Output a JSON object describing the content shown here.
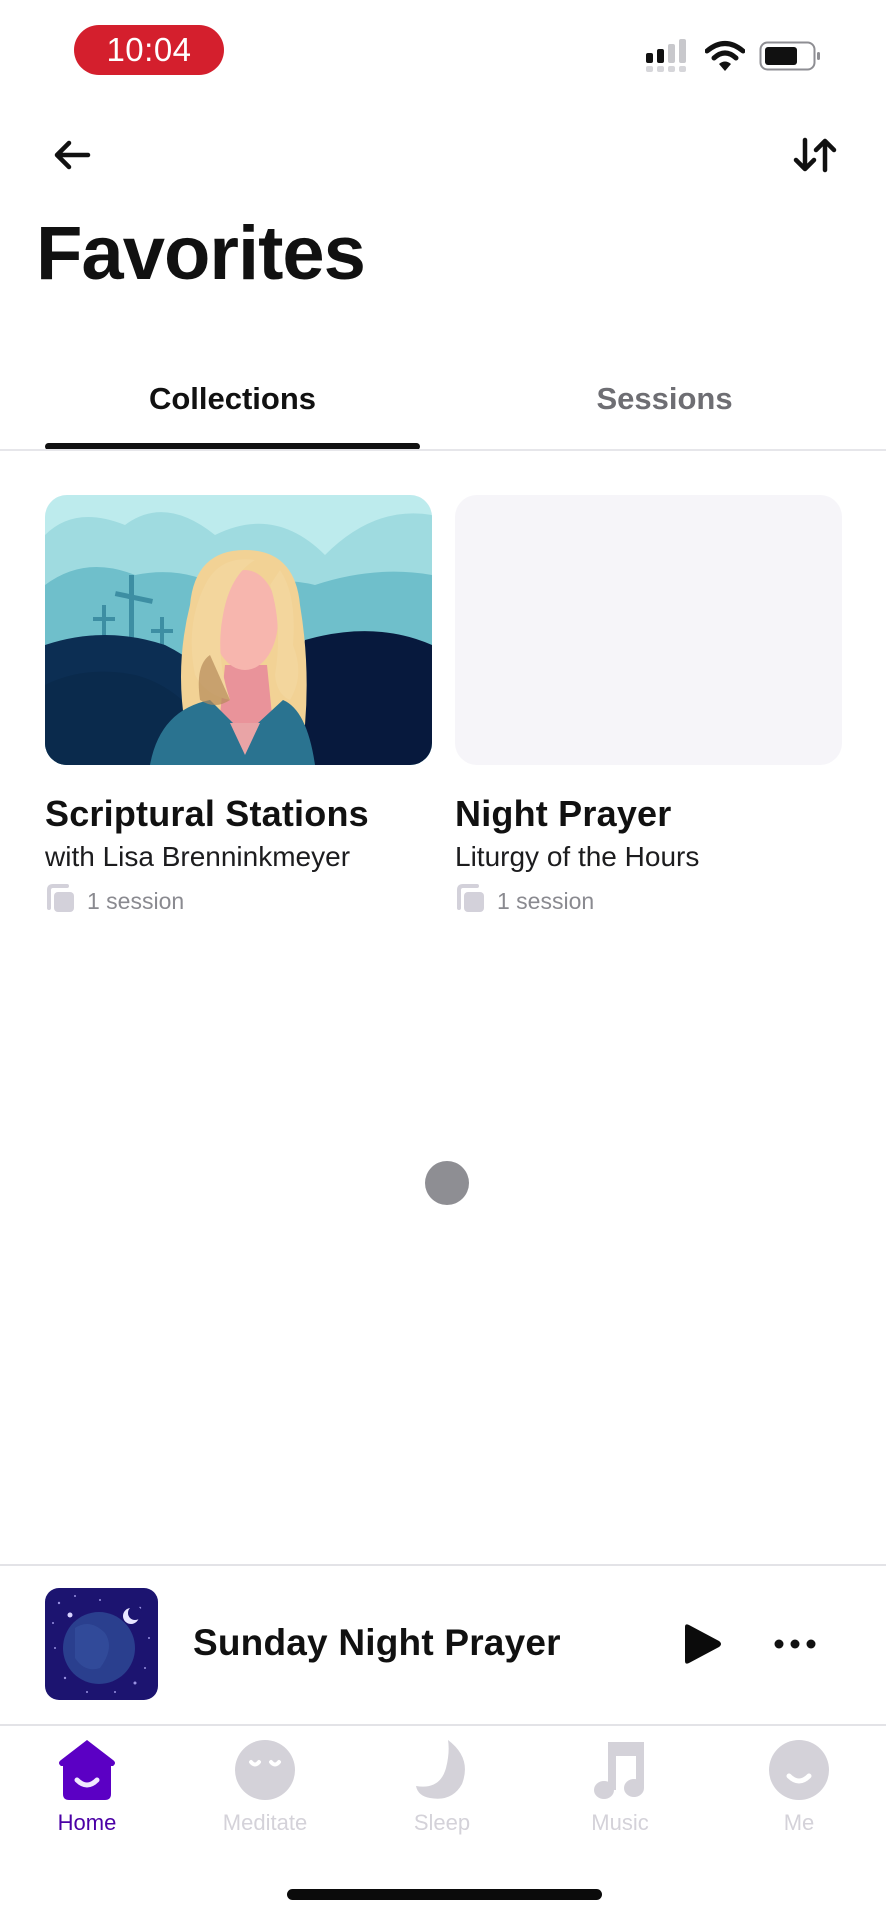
{
  "status_bar": {
    "time": "10:04",
    "signal_icon": "cellular-signal-icon",
    "wifi_icon": "wifi-icon",
    "battery_icon": "battery-icon",
    "time_pill_color": "#d41f2d"
  },
  "header": {
    "back_icon": "arrow-left-icon",
    "sort_icon": "sort-arrows-icon",
    "title": "Favorites"
  },
  "tabs": {
    "items": [
      {
        "label": "Collections",
        "active": true
      },
      {
        "label": "Sessions",
        "active": false
      }
    ]
  },
  "collections": [
    {
      "title": "Scriptural Stations",
      "subtitle": "with Lisa Brenninkmeyer",
      "sessions": "1 session",
      "image": "illustration-woman-three-crosses"
    },
    {
      "title": "Night Prayer",
      "subtitle": "Liturgy of the Hours",
      "sessions": "1 session",
      "image": "placeholder-loading"
    }
  ],
  "mini_player": {
    "title": "Sunday Night Prayer",
    "thumbnail": "night-sky-earth-moon",
    "play_icon": "play-icon",
    "more_icon": "more-horizontal-icon"
  },
  "tab_bar": {
    "items": [
      {
        "label": "Home",
        "icon": "home-smile-icon",
        "active": true
      },
      {
        "label": "Meditate",
        "icon": "meditate-face-icon",
        "active": false
      },
      {
        "label": "Sleep",
        "icon": "moon-icon",
        "active": false
      },
      {
        "label": "Music",
        "icon": "music-note-icon",
        "active": false
      },
      {
        "label": "Me",
        "icon": "profile-smile-icon",
        "active": false
      }
    ],
    "active_color": "#5b00c4",
    "inactive_color": "#d4d2d9"
  }
}
